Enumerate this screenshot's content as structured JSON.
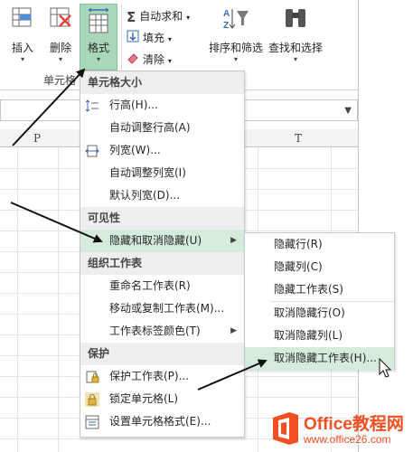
{
  "ribbon": {
    "insert_label": "插入",
    "delete_label": "删除",
    "format_label": "格式",
    "group_cells_label": "单元格",
    "autosum_label": "自动求和",
    "fill_label": "填充",
    "clear_label": "清除",
    "sort_filter_label": "排序和筛选",
    "find_select_label": "查找和选择"
  },
  "sheet": {
    "columns": [
      "P",
      "T"
    ]
  },
  "format_menu": {
    "sections": [
      {
        "header": "单元格大小"
      },
      {
        "header": "可见性"
      },
      {
        "header": "组织工作表"
      },
      {
        "header": "保护"
      }
    ],
    "items": [
      {
        "label": "行高(H)..."
      },
      {
        "label": "自动调整行高(A)"
      },
      {
        "label": "列宽(W)..."
      },
      {
        "label": "自动调整列宽(I)"
      },
      {
        "label": "默认列宽(D)..."
      },
      {
        "label": "隐藏和取消隐藏(U)"
      },
      {
        "label": "重命名工作表(R)"
      },
      {
        "label": "移动或复制工作表(M)..."
      },
      {
        "label": "工作表标签颜色(T)"
      },
      {
        "label": "保护工作表(P)..."
      },
      {
        "label": "锁定单元格(L)"
      },
      {
        "label": "设置单元格格式(E)..."
      }
    ]
  },
  "submenu": {
    "items": [
      {
        "label": "隐藏行(R)"
      },
      {
        "label": "隐藏列(C)"
      },
      {
        "label": "隐藏工作表(S)"
      },
      {
        "label": "取消隐藏行(O)"
      },
      {
        "label": "取消隐藏列(L)"
      },
      {
        "label": "取消隐藏工作表(H)..."
      }
    ]
  },
  "watermark": {
    "title": "Office教程网",
    "url": "www.office26.com"
  },
  "colors": {
    "accent_green": "#a8d8b9",
    "highlight": "#d5ecdc",
    "brand_orange": "#f25022"
  }
}
